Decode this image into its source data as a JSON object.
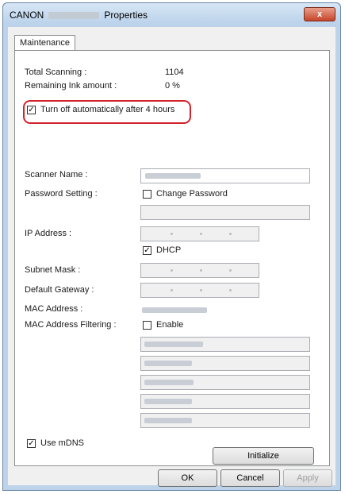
{
  "window": {
    "title_prefix": "CANON",
    "title_suffix": "Properties",
    "close_label": "x"
  },
  "tabs": [
    "Maintenance"
  ],
  "maintenance": {
    "total_scanning_label": "Total Scanning :",
    "total_scanning_value": "1104",
    "remaining_ink_label": "Remaining Ink amount :",
    "remaining_ink_value": "0 %",
    "auto_off_label": "Turn off automatically after 4 hours",
    "auto_off_checked": true
  },
  "network": {
    "scanner_name_label": "Scanner Name :",
    "password_setting_label": "Password Setting :",
    "change_password_label": "Change Password",
    "change_password_checked": false,
    "ip_address_label": "IP Address :",
    "dhcp_label": "DHCP",
    "dhcp_checked": true,
    "subnet_mask_label": "Subnet Mask :",
    "default_gateway_label": "Default Gateway :",
    "mac_address_label": "MAC Address :",
    "mac_filtering_label": "MAC Address Filtering :",
    "enable_label": "Enable",
    "enable_checked": false,
    "use_mdns_label": "Use mDNS",
    "use_mdns_checked": true
  },
  "buttons": {
    "initialize": "Initialize",
    "ok": "OK",
    "cancel": "Cancel",
    "apply": "Apply"
  },
  "colors": {
    "highlight": "#d2232a",
    "window_frame": "#bcd3ea"
  }
}
